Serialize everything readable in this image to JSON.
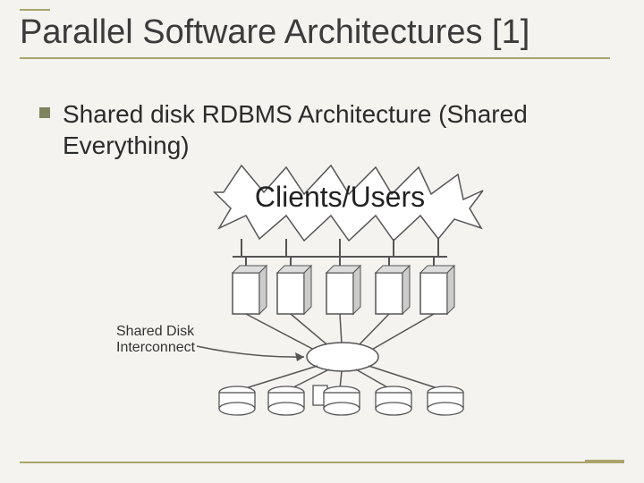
{
  "title": "Parallel Software Architectures [1]",
  "bullets": [
    {
      "text": "Shared disk RDBMS Architecture (Shared Everything)"
    }
  ],
  "diagram": {
    "clients_label": "Clients/Users",
    "interconnect_label_line1": "Shared Disk",
    "interconnect_label_line2": "Interconnect"
  }
}
